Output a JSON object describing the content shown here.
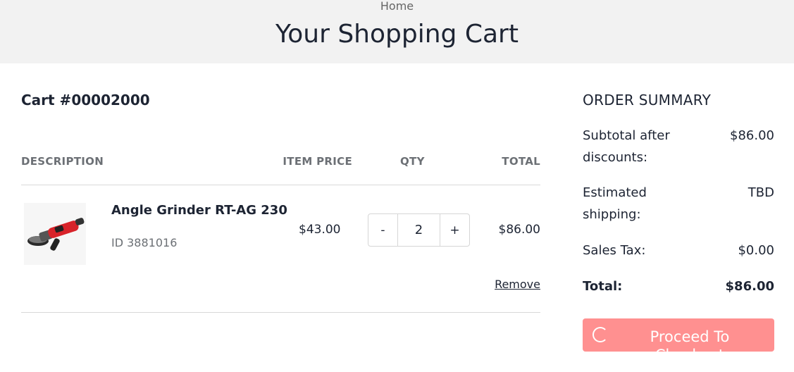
{
  "header": {
    "breadcrumb": "Home",
    "title": "Your Shopping Cart"
  },
  "cart": {
    "title": "Cart #00002000",
    "columns": {
      "description": "DESCRIPTION",
      "item_price": "ITEM PRICE",
      "qty": "QTY",
      "total": "TOTAL"
    },
    "items": [
      {
        "image_icon": "angle-grinder-image",
        "name": "Angle Grinder RT-AG 230",
        "id": "ID 3881016",
        "price": "$43.00",
        "qty_minus": "-",
        "qty": "2",
        "qty_plus": "+",
        "total": "$86.00",
        "remove": "Remove"
      }
    ]
  },
  "summary": {
    "title": "ORDER SUMMARY",
    "subtotal_label": "Subtotal after discounts:",
    "subtotal_value": "$86.00",
    "shipping_label": "Estimated shipping:",
    "shipping_value": "TBD",
    "tax_label": "Sales Tax:",
    "tax_value": "$0.00",
    "total_label": "Total:",
    "total_value": "$86.00",
    "proceed_label": "Proceed To Checkout"
  },
  "colors": {
    "proceed_button": "#ff9090",
    "header_bg": "#f2f2f2",
    "text": "#1d2433",
    "muted": "#6c7075"
  }
}
